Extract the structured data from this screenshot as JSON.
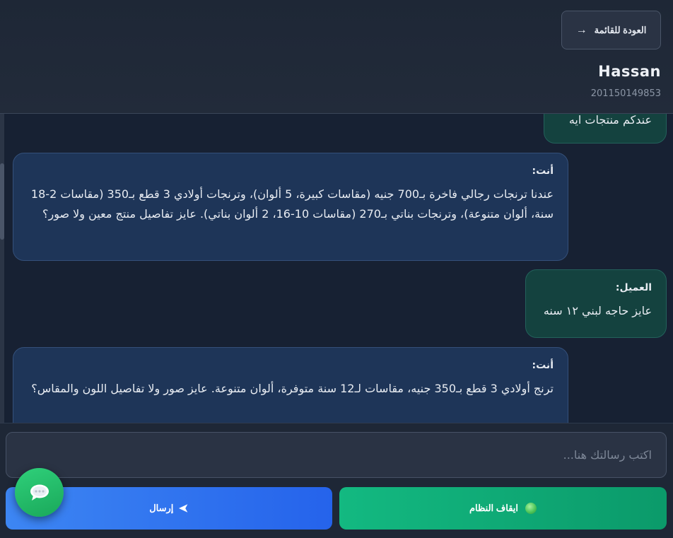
{
  "header": {
    "back_label": "العودة للقائمة",
    "back_arrow": "→",
    "contact_name": "Hassan",
    "contact_phone": "201150149853"
  },
  "messages": [
    {
      "role": "customer",
      "sender": "",
      "text": "عندكم منتجات ايه"
    },
    {
      "role": "agent",
      "sender": "أنت:",
      "text": "عندنا ترنجات رجالي فاخرة بـ700 جنيه (مقاسات كبيرة، 5 ألوان)، وترنجات أولادي 3 قطع بـ350 (مقاسات 2-18 سنة، ألوان متنوعة)، وترنجات بناتي بـ270 (مقاسات 10-16، 2 ألوان بناتي). عايز تفاصيل منتج معين ولا صور؟"
    },
    {
      "role": "customer",
      "sender": "العميل:",
      "text": "عايز حاجه لبني ١٢ سنه"
    },
    {
      "role": "agent",
      "sender": "أنت:",
      "text": "ترنج أولادي 3 قطع بـ350 جنيه، مقاسات لـ12 سنة متوفرة، ألوان متنوعة. عايز صور ولا تفاصيل اللون والمقاس؟"
    }
  ],
  "composer": {
    "placeholder": "اكتب رسالتك هنا..."
  },
  "actions": {
    "send_label": "إرسال",
    "send_icon": "send-plane-icon",
    "stop_label": "ايقاف النظام",
    "stop_icon": "status-dot-icon"
  },
  "fab": {
    "icon": "chat-bubble-icon"
  },
  "colors": {
    "background": "#172133",
    "agent_bubble": "#1e3558",
    "customer_bubble": "#14423f",
    "send_button": "#2563eb",
    "stop_button": "#10b981",
    "fab": "#22c06b"
  }
}
